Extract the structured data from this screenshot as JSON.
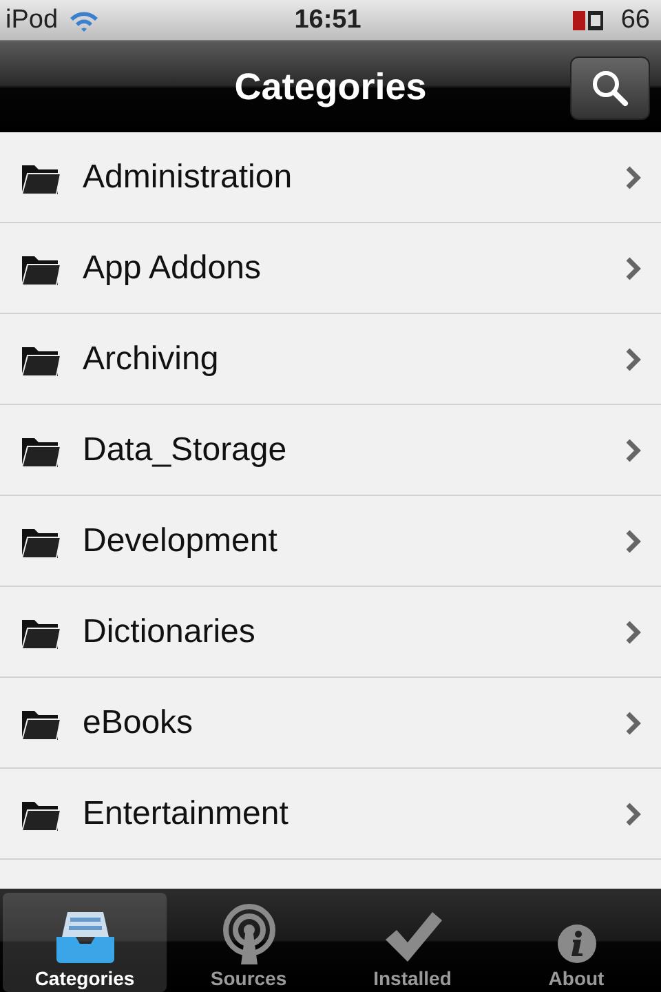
{
  "status_bar": {
    "carrier": "iPod",
    "time": "16:51",
    "battery": "66"
  },
  "nav_bar": {
    "title": "Categories"
  },
  "categories": [
    {
      "label": "Administration"
    },
    {
      "label": "App Addons"
    },
    {
      "label": "Archiving"
    },
    {
      "label": "Data_Storage"
    },
    {
      "label": "Development"
    },
    {
      "label": "Dictionaries"
    },
    {
      "label": "eBooks"
    },
    {
      "label": "Entertainment"
    }
  ],
  "tabs": [
    {
      "label": "Categories",
      "kind": "tray",
      "selected": true
    },
    {
      "label": "Sources",
      "kind": "antenna",
      "selected": false
    },
    {
      "label": "Installed",
      "kind": "check",
      "selected": false
    },
    {
      "label": "About",
      "kind": "info",
      "selected": false
    }
  ]
}
